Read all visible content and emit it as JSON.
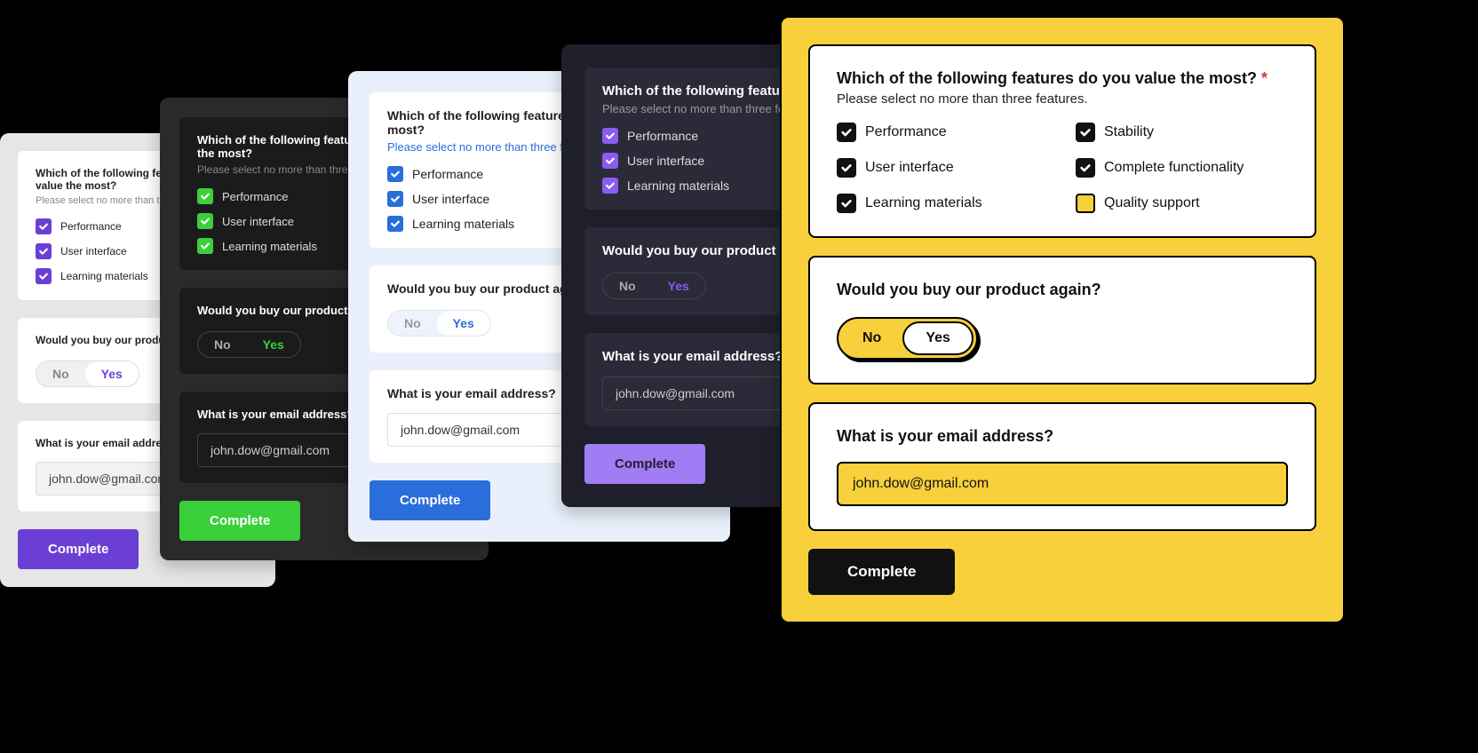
{
  "questions": {
    "q1_title": "Which of the following features do you value the most?",
    "q1_sub": "Please select no more than three features.",
    "q2_title": "Would you buy our product again?",
    "q3_title": "What is your email address?"
  },
  "required_mark": "*",
  "options_short": [
    "Performance",
    "User interface",
    "Learning materials"
  ],
  "options_full": [
    {
      "label": "Performance",
      "checked": true
    },
    {
      "label": "Stability",
      "checked": true
    },
    {
      "label": "User interface",
      "checked": true
    },
    {
      "label": "Complete functionality",
      "checked": true
    },
    {
      "label": "Learning materials",
      "checked": true
    },
    {
      "label": "Quality support",
      "checked": false
    }
  ],
  "toggle": {
    "no": "No",
    "yes": "Yes",
    "selected": "yes"
  },
  "email_value": "john.dow@gmail.com",
  "button_label": "Complete",
  "themes": {
    "c1": {
      "accent": "#6b3fd4"
    },
    "c2": {
      "accent": "#3bcf3b"
    },
    "c3": {
      "accent": "#2a6edb"
    },
    "c4": {
      "accent": "#8a5cf0"
    },
    "c5": {
      "accent": "#f7d03c"
    }
  }
}
